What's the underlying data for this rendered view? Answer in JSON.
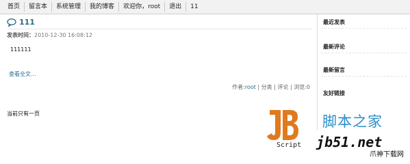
{
  "nav": {
    "items": [
      "首页",
      "留言本",
      "系统管理",
      "我的博客",
      "欢迎你，root",
      "退出",
      "11"
    ]
  },
  "post": {
    "title": "111",
    "meta_label": "发表时间：",
    "meta_value": "2010-12-30 16:08:12",
    "body": "111111",
    "read_more": "查看全文...",
    "footer_prefix": "作者:",
    "footer_author": "root",
    "footer_rest": " | 分类 | 评论 | 浏览:0"
  },
  "pager": {
    "text": "当前只有一页"
  },
  "sidebar": {
    "headings": [
      "最近发表",
      "最新评论",
      "最新留言",
      "友好链接"
    ]
  },
  "watermark": {
    "script_label": "Script",
    "site_cn": "脚本之家",
    "site_url": "jb51.net",
    "site_small": "爪神下载网"
  },
  "colors": {
    "link": "#2a6c8a",
    "logo_orange": "#e07a1e",
    "watermark_blue": "#2a8ec8"
  }
}
